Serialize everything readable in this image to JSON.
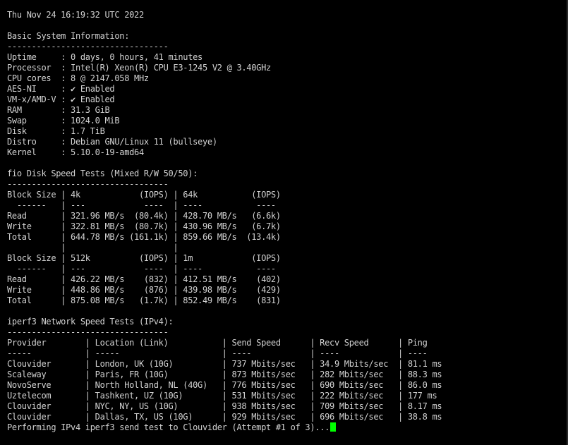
{
  "terminal": {
    "lines": [
      "Thu Nov 24 16:19:32 UTC 2022",
      "",
      "Basic System Information:",
      "---------------------------------",
      "Uptime     : 0 days, 0 hours, 41 minutes",
      "Processor  : Intel(R) Xeon(R) CPU E3-1245 V2 @ 3.40GHz",
      "CPU cores  : 8 @ 2147.058 MHz",
      "AES-NI     : ✔ Enabled",
      "VM-x/AMD-V : ✔ Enabled",
      "RAM        : 31.3 GiB",
      "Swap       : 1024.0 MiB",
      "Disk       : 1.7 TiB",
      "Distro     : Debian GNU/Linux 11 (bullseye)",
      "Kernel     : 5.10.0-19-amd64",
      "",
      "fio Disk Speed Tests (Mixed R/W 50/50):",
      "---------------------------------",
      "Block Size | 4k            (IOPS) | 64k           (IOPS)",
      "  ------   | ---            ----  | ----           ----",
      "Read       | 321.96 MB/s  (80.4k) | 428.70 MB/s   (6.6k)",
      "Write      | 322.81 MB/s  (80.7k) | 430.96 MB/s   (6.7k)",
      "Total      | 644.78 MB/s (161.1k) | 859.66 MB/s  (13.4k)",
      "           |                      |",
      "Block Size | 512k          (IOPS) | 1m            (IOPS)",
      "  ------   | ---            ----  | ----           ----",
      "Read       | 426.22 MB/s    (832) | 412.51 MB/s    (402)",
      "Write      | 448.86 MB/s    (876) | 439.98 MB/s    (429)",
      "Total      | 875.08 MB/s   (1.7k) | 852.49 MB/s    (831)",
      "",
      "iperf3 Network Speed Tests (IPv4):",
      "---------------------------------",
      "Provider        | Location (Link)           | Send Speed      | Recv Speed      | Ping",
      "-----           | -----                     | ----            | ----            | ----",
      "Clouvider       | London, UK (10G)          | 737 Mbits/sec   | 34.9 Mbits/sec  | 81.1 ms",
      "Scaleway        | Paris, FR (10G)           | 873 Mbits/sec   | 282 Mbits/sec   | 88.3 ms",
      "NovoServe       | North Holland, NL (40G)   | 776 Mbits/sec   | 690 Mbits/sec   | 86.0 ms",
      "Uztelecom       | Tashkent, UZ (10G)        | 531 Mbits/sec   | 222 Mbits/sec   | 177 ms",
      "Clouvider       | NYC, NY, US (10G)         | 938 Mbits/sec   | 709 Mbits/sec   | 8.17 ms",
      "Clouvider       | Dallas, TX, US (10G)      | 929 Mbits/sec   | 696 Mbits/sec   | 38.8 ms"
    ],
    "last_line": "Performing IPv4 iperf3 send test to Clouvider (Attempt #1 of 3)...",
    "cursor_color": "#00ff00",
    "text_color": "#d2d2d2",
    "background_color": "#000000"
  }
}
